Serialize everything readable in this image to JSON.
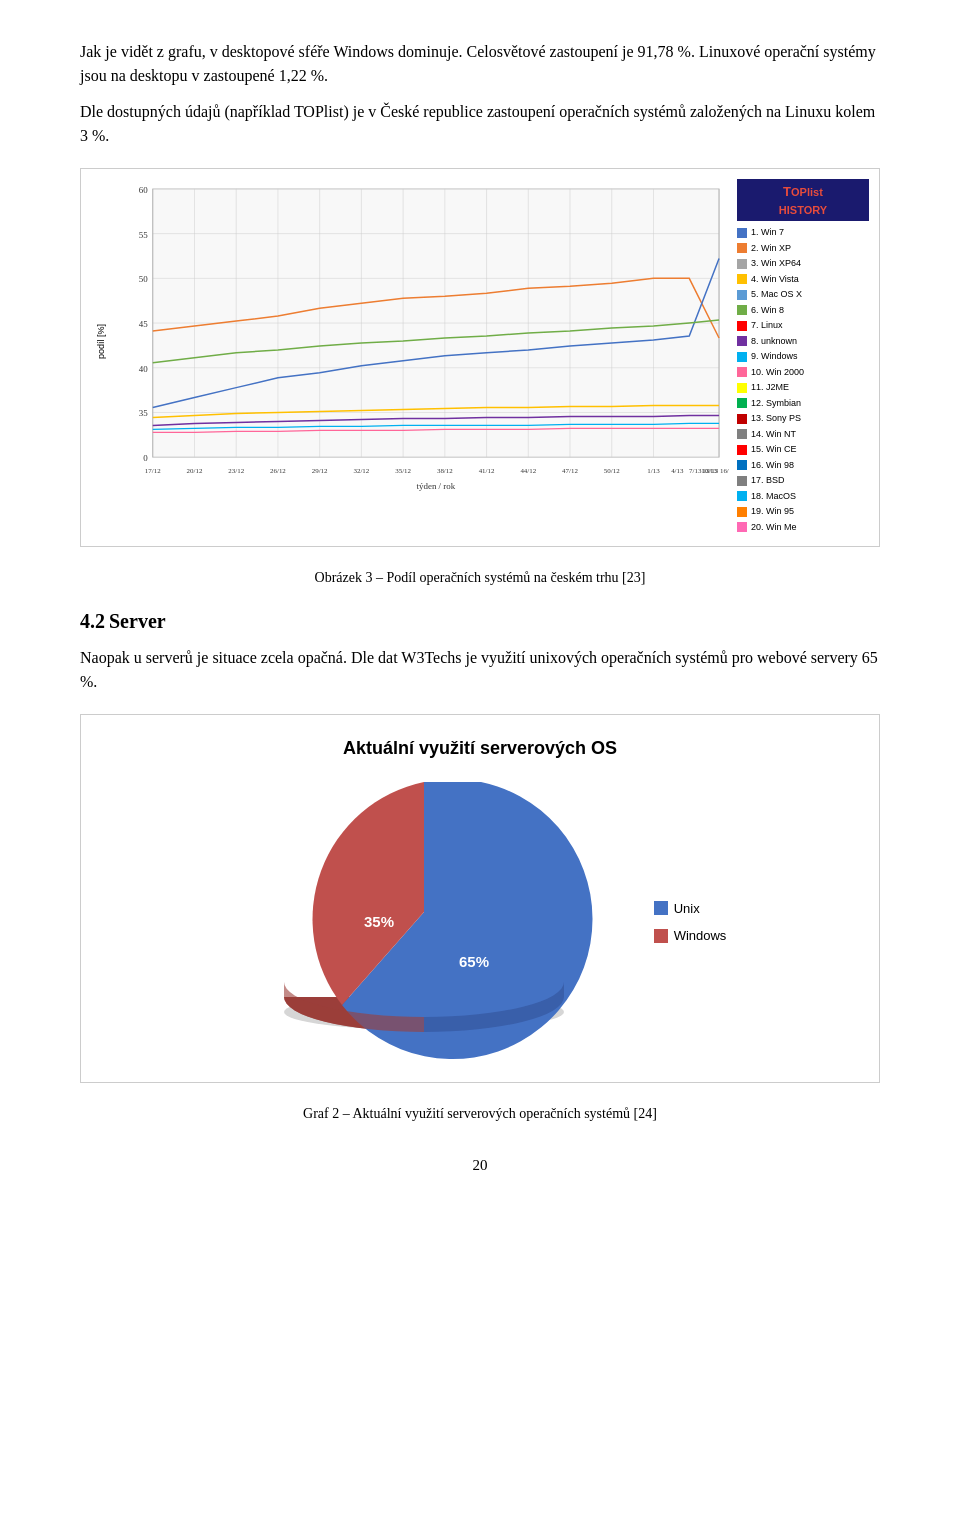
{
  "paragraphs": {
    "p1": "Jak je vidět z grafu, v desktopové sféře Windows dominuje. Celosvětové zastoupení je 91,78 %. Linuxové operační systémy jsou na desktopu v zastoupené 1,22 %.",
    "p2": "Dle dostupných údajů (například TOPlist) je v České republice zastoupení operačních systémů založených na Linuxu kolem 3 %."
  },
  "chart1": {
    "caption": "Obrázek 3 – Podíl operačních systémů na českém trhu [23]",
    "logo_text": "HISTORY",
    "logo_top": "T",
    "y_label": "podíl [%]",
    "x_label": "týden / rok",
    "legend": [
      {
        "color": "#4472C4",
        "label": "1. Win 7"
      },
      {
        "color": "#ED7D31",
        "label": "2. Win XP"
      },
      {
        "color": "#A5A5A5",
        "label": "3. Win XP64"
      },
      {
        "color": "#FFC000",
        "label": "4. Win Vista"
      },
      {
        "color": "#5B9BD5",
        "label": "5. Mac OS X"
      },
      {
        "color": "#70AD47",
        "label": "6. Win 8"
      },
      {
        "color": "#FF0000",
        "label": "7. Linux"
      },
      {
        "color": "#7030A0",
        "label": "8. unknown"
      },
      {
        "color": "#00B0F0",
        "label": "9. Windows"
      },
      {
        "color": "#FF6699",
        "label": "10. Win 2000"
      },
      {
        "color": "#FFFF00",
        "label": "11. J2ME"
      },
      {
        "color": "#00B050",
        "label": "12. Symbian"
      },
      {
        "color": "#C00000",
        "label": "13. Sony PS"
      },
      {
        "color": "#808080",
        "label": "14. Win NT"
      },
      {
        "color": "#FF0000",
        "label": "15. Win CE"
      },
      {
        "color": "#0070C0",
        "label": "16. Win 98"
      },
      {
        "color": "#7F7F7F",
        "label": "17. BSD"
      },
      {
        "color": "#00B0F0",
        "label": "18. MacOS"
      },
      {
        "color": "#FF7F00",
        "label": "19. Win 95"
      },
      {
        "color": "#FF69B4",
        "label": "20. Win Me"
      }
    ]
  },
  "section42": {
    "number": "4.2",
    "title": "Server",
    "p1": "Naopak u serverů je situace zcela opačná. Dle dat W3Techs je využití unixových operačních systémů pro webové servery 65 %."
  },
  "chart2": {
    "title": "Aktuální využití serverových OS",
    "unix_pct": "65%",
    "windows_pct": "35%",
    "unix_color": "#4472C4",
    "windows_color": "#C0504D",
    "caption": "Graf 2 – Aktuální využití serverových operačních systémů [24]",
    "legend": [
      {
        "color": "#4472C4",
        "label": "Unix"
      },
      {
        "color": "#C0504D",
        "label": "Windows"
      }
    ]
  },
  "page_number": "20"
}
